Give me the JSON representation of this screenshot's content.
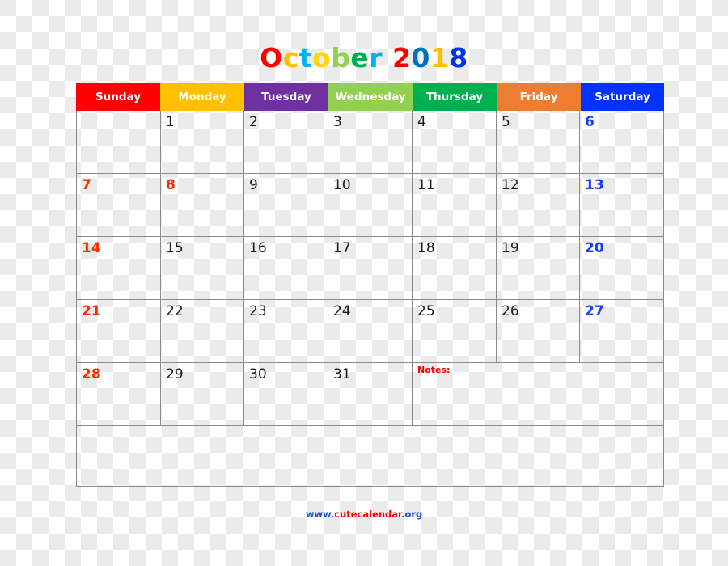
{
  "title": {
    "letters": [
      {
        "ch": "O",
        "color": "#ff0000"
      },
      {
        "ch": "c",
        "color": "#ffc000"
      },
      {
        "ch": "t",
        "color": "#00b0f0"
      },
      {
        "ch": "o",
        "color": "#ffd800"
      },
      {
        "ch": "b",
        "color": "#92d050"
      },
      {
        "ch": "e",
        "color": "#00b050"
      },
      {
        "ch": "r",
        "color": "#00b0f0"
      },
      {
        "ch": " ",
        "color": "#000000"
      },
      {
        "ch": "2",
        "color": "#ff0000"
      },
      {
        "ch": "0",
        "color": "#0070c0"
      },
      {
        "ch": "1",
        "color": "#ffc000"
      },
      {
        "ch": "8",
        "color": "#0033ee"
      }
    ],
    "text": "October 2018"
  },
  "weekdays": [
    {
      "label": "Sunday",
      "color": "#ff0000"
    },
    {
      "label": "Monday",
      "color": "#ffc000"
    },
    {
      "label": "Tuesday",
      "color": "#7030a0"
    },
    {
      "label": "Wednesday",
      "color": "#92d050"
    },
    {
      "label": "Thursday",
      "color": "#00b050"
    },
    {
      "label": "Friday",
      "color": "#ed7d31"
    },
    {
      "label": "Saturday",
      "color": "#0033ff"
    }
  ],
  "weeks": [
    [
      null,
      {
        "d": "1"
      },
      {
        "d": "2"
      },
      {
        "d": "3"
      },
      {
        "d": "4"
      },
      {
        "d": "5"
      },
      {
        "d": "6",
        "style": "blue"
      }
    ],
    [
      {
        "d": "7",
        "style": "red"
      },
      {
        "d": "8",
        "style": "red"
      },
      {
        "d": "9"
      },
      {
        "d": "10"
      },
      {
        "d": "11"
      },
      {
        "d": "12"
      },
      {
        "d": "13",
        "style": "blue"
      }
    ],
    [
      {
        "d": "14",
        "style": "red"
      },
      {
        "d": "15"
      },
      {
        "d": "16"
      },
      {
        "d": "17"
      },
      {
        "d": "18"
      },
      {
        "d": "19"
      },
      {
        "d": "20",
        "style": "blue"
      }
    ],
    [
      {
        "d": "21",
        "style": "red"
      },
      {
        "d": "22"
      },
      {
        "d": "23"
      },
      {
        "d": "24"
      },
      {
        "d": "25"
      },
      {
        "d": "26"
      },
      {
        "d": "27",
        "style": "blue"
      }
    ],
    [
      {
        "d": "28",
        "style": "red"
      },
      {
        "d": "29"
      },
      {
        "d": "30"
      },
      {
        "d": "31"
      }
    ]
  ],
  "notes_label": "Notes:",
  "footer": {
    "parts": [
      {
        "text": "www.",
        "color": "#1f4fd6"
      },
      {
        "text": "cutecalendar",
        "color": "#ff0000"
      },
      {
        "text": ".org",
        "color": "#1f4fd6"
      }
    ]
  }
}
